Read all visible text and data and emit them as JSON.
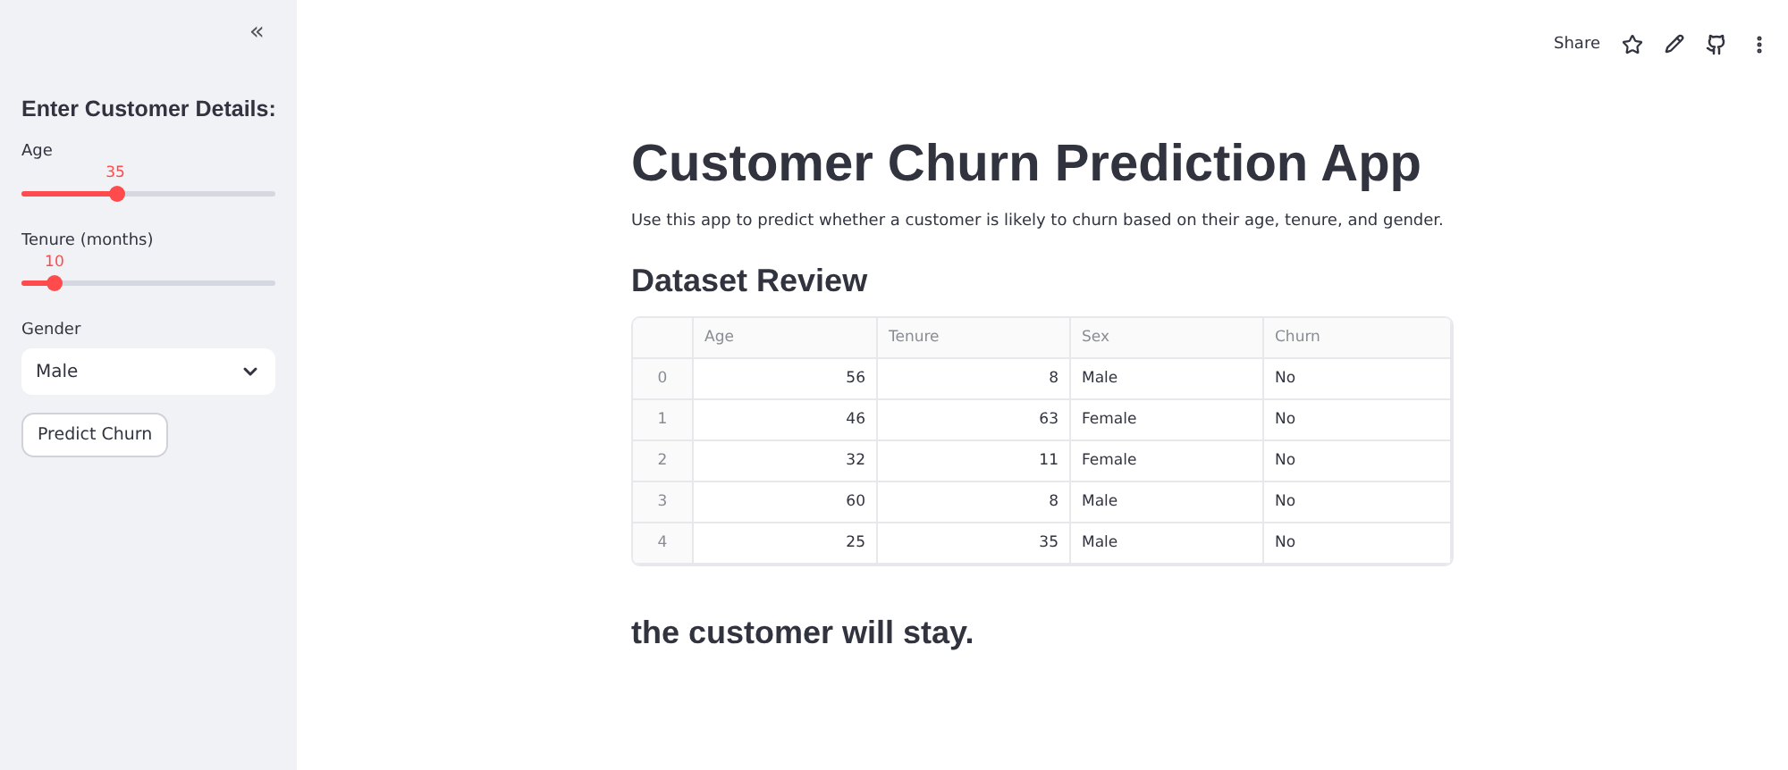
{
  "sidebar": {
    "collapse_icon": "«",
    "heading": "Enter Customer Details:",
    "sliders": [
      {
        "label": "Age",
        "reading": "35",
        "level": 0.37
      },
      {
        "label": "Tenure (months)",
        "reading": "10",
        "level": 0.13
      }
    ],
    "select": {
      "label": "Gender",
      "value": "Male"
    },
    "button": "Predict Churn"
  },
  "toolbar": {
    "share": "Share"
  },
  "main": {
    "title": "Customer Churn Prediction App",
    "description": "Use this app to predict whether a customer is likely to churn based on their age, tenure, and gender.",
    "section_title": "Dataset Review",
    "table": {
      "columns": [
        "",
        "Age",
        "Tenure",
        "Sex",
        "Churn"
      ],
      "rows": [
        [
          "0",
          "56",
          "8",
          "Male",
          "No"
        ],
        [
          "1",
          "46",
          "63",
          "Female",
          "No"
        ],
        [
          "2",
          "32",
          "11",
          "Female",
          "No"
        ],
        [
          "3",
          "60",
          "8",
          "Male",
          "No"
        ],
        [
          "4",
          "25",
          "35",
          "Male",
          "No"
        ]
      ]
    },
    "result": "the customer will stay."
  }
}
